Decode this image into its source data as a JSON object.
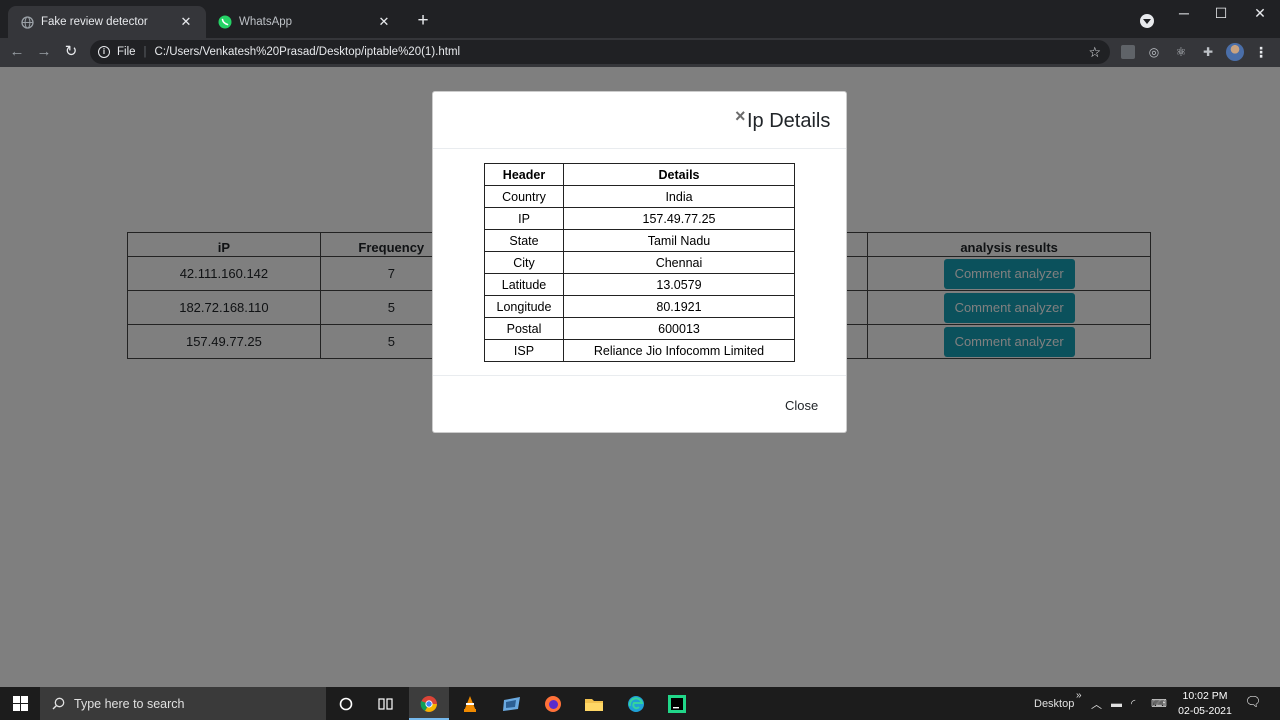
{
  "browser": {
    "tabs": [
      {
        "title": "Fake review detector",
        "active": true,
        "favicon": "globe-icon"
      },
      {
        "title": "WhatsApp",
        "active": false,
        "favicon": "whatsapp-icon"
      }
    ],
    "address": {
      "scheme": "File",
      "url": "C:/Users/Venkatesh%20Prasad/Desktop/iptable%20(1).html"
    }
  },
  "page": {
    "table": {
      "headers": [
        "iP",
        "Frequency",
        "analysis results"
      ],
      "rows": [
        {
          "ip": "42.111.160.142",
          "frequency": "7",
          "action": "Comment analyzer"
        },
        {
          "ip": "182.72.168.110",
          "frequency": "5",
          "action": "Comment analyzer"
        },
        {
          "ip": "157.49.77.25",
          "frequency": "5",
          "action": "Comment analyzer"
        }
      ]
    }
  },
  "modal": {
    "close_glyph": "×",
    "title": "Ip Details",
    "headers": [
      "Header",
      "Details"
    ],
    "rows": [
      {
        "key": "Country",
        "value": "India"
      },
      {
        "key": "IP",
        "value": "157.49.77.25"
      },
      {
        "key": "State",
        "value": "Tamil Nadu"
      },
      {
        "key": "City",
        "value": "Chennai"
      },
      {
        "key": "Latitude",
        "value": "13.0579"
      },
      {
        "key": "Longitude",
        "value": "80.1921"
      },
      {
        "key": "Postal",
        "value": "600013"
      },
      {
        "key": "ISP",
        "value": "Reliance Jio Infocomm Limited"
      }
    ],
    "footer_close": "Close"
  },
  "taskbar": {
    "search_placeholder": "Type here to search",
    "desktop_label": "Desktop",
    "time": "10:02 PM",
    "date": "02-05-2021"
  },
  "colors": {
    "accent_button": "#17a2b8",
    "chrome_dark": "#202124",
    "backdrop": "rgba(0,0,0,0.5)"
  }
}
